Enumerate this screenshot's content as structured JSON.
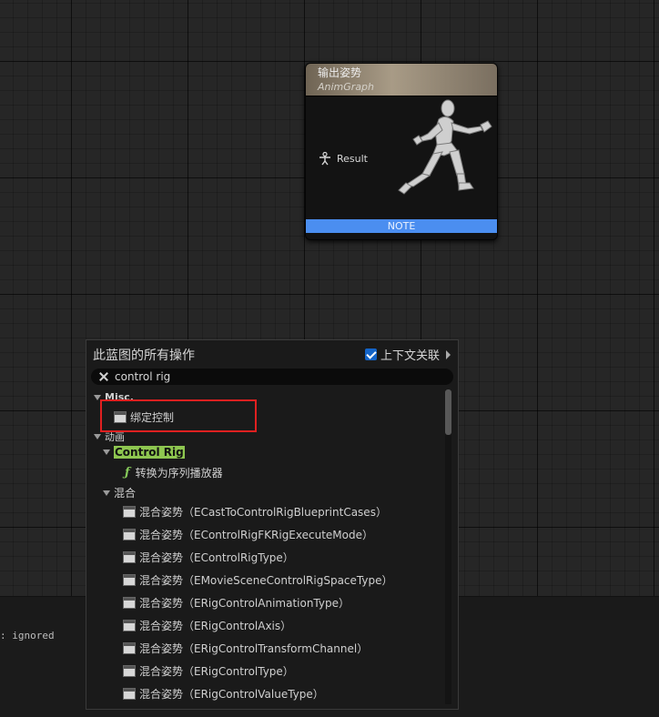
{
  "node": {
    "title": "输出姿势",
    "subtitle": "AnimGraph",
    "pin_label": "Result",
    "note_label": "NOTE"
  },
  "menu": {
    "title": "此蓝图的所有操作",
    "context_sensitive_label": "上下文关联",
    "context_sensitive_checked": true,
    "search_value": "control rig",
    "categories": {
      "misc": "Misc.",
      "misc_item": "绑定控制",
      "animation": "动画",
      "control_rig": "Control Rig",
      "control_rig_item": "转换为序列播放器",
      "blend": "混合"
    },
    "blend_items": [
      "混合姿势（ECastToControlRigBlueprintCases）",
      "混合姿势（EControlRigFKRigExecuteMode）",
      "混合姿势（EControlRigType）",
      "混合姿势（EMovieSceneControlRigSpaceType）",
      "混合姿势（ERigControlAnimationType）",
      "混合姿势（ERigControlAxis）",
      "混合姿势（ERigControlTransformChannel）",
      "混合姿势（ERigControlType）",
      "混合姿势（ERigControlValueType）"
    ]
  },
  "log": {
    "line": ": ignored"
  },
  "colors": {
    "note_bar": "#4b8ef0",
    "highlight": "#8ec650",
    "annotation_box": "#e02020"
  }
}
